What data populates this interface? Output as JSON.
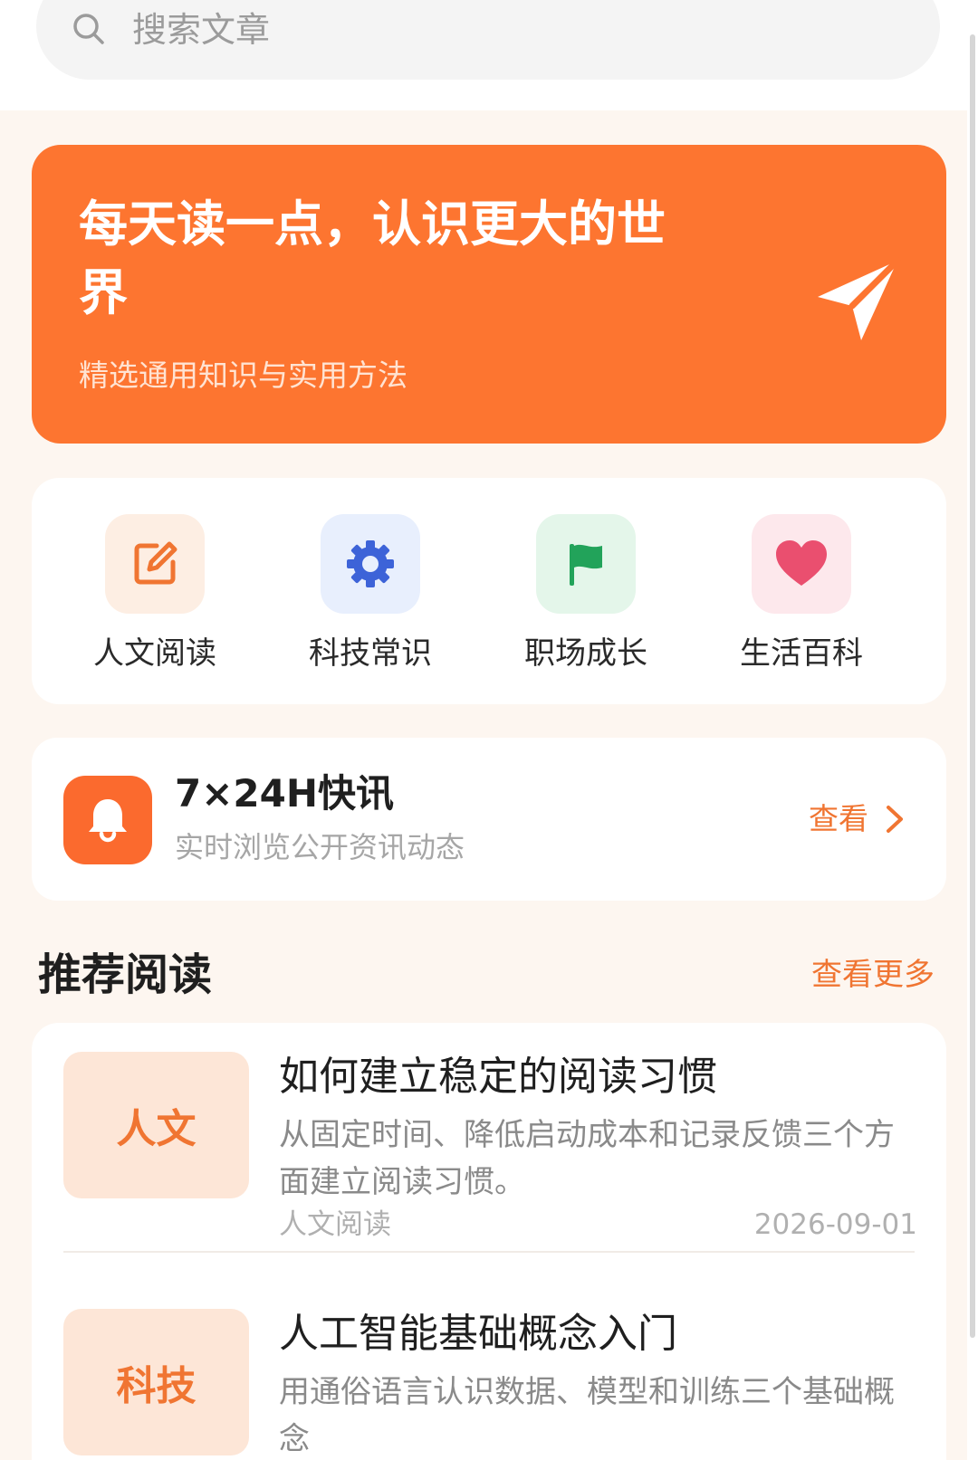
{
  "search": {
    "placeholder": "搜索文章"
  },
  "hero": {
    "title": "每天读一点，认识更大的世界",
    "subtitle": "精选通用知识与实用方法",
    "icon": "send-icon"
  },
  "categories": [
    {
      "label": "人文阅读",
      "icon": "edit-icon",
      "color": "#f07532",
      "bg": "#fdeee3"
    },
    {
      "label": "科技常识",
      "icon": "gear-icon",
      "color": "#3d63d8",
      "bg": "#e8effd"
    },
    {
      "label": "职场成长",
      "icon": "flag-icon",
      "color": "#22a35a",
      "bg": "#e4f6ea"
    },
    {
      "label": "生活百科",
      "icon": "heart-icon",
      "color": "#ea4f6f",
      "bg": "#fde8ec"
    }
  ],
  "news": {
    "title": "7×24H快讯",
    "subtitle": "实时浏览公开资讯动态",
    "action": "查看",
    "icon": "bell-icon"
  },
  "recommended": {
    "title": "推荐阅读",
    "more": "查看更多",
    "articles": [
      {
        "thumb": "人文",
        "title": "如何建立稳定的阅读习惯",
        "summary": "从固定时间、降低启动成本和记录反馈三个方面建立阅读习惯。",
        "category": "人文阅读",
        "date": "2026-09-01"
      },
      {
        "thumb": "科技",
        "title": "人工智能基础概念入门",
        "summary": "用通俗语言认识数据、模型和训练三个基础概念",
        "category": "",
        "date": ""
      }
    ]
  },
  "colors": {
    "accent": "#fd7530",
    "background": "#fdf6f0"
  }
}
